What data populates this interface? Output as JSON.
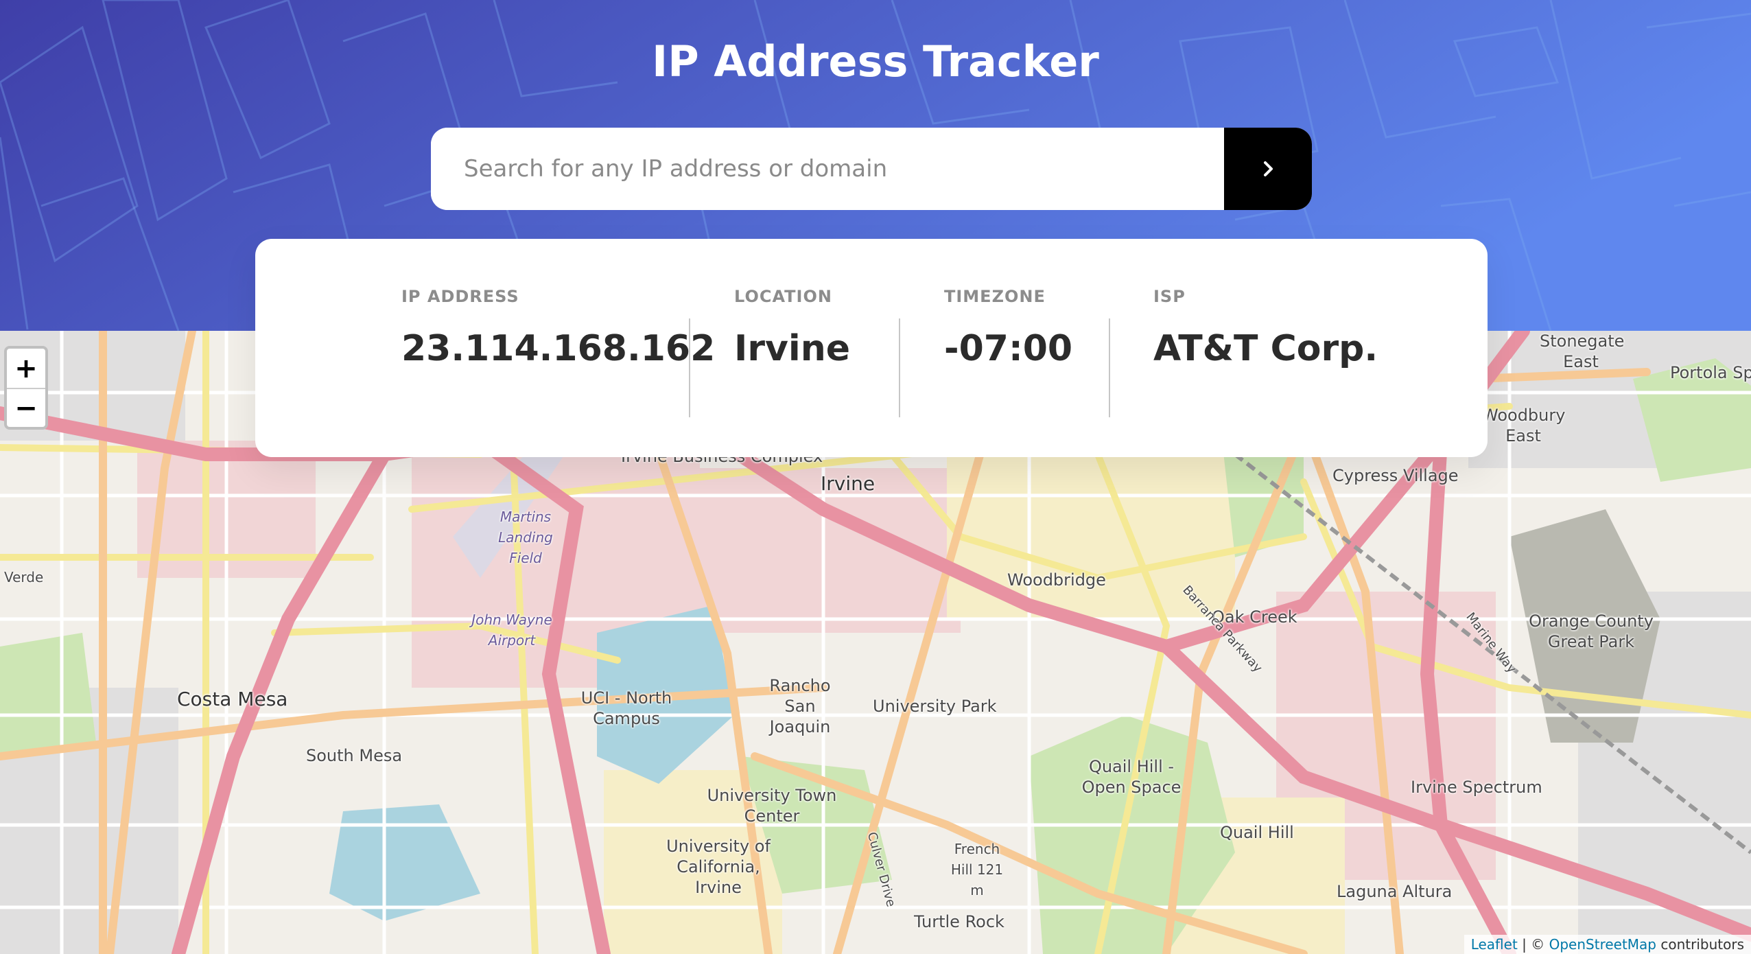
{
  "header": {
    "title": "IP Address Tracker",
    "gradient_start": "#3f3fa8",
    "gradient_end": "#5f87ee"
  },
  "search": {
    "placeholder": "Search for any IP address or domain",
    "value": "",
    "submit_icon": "chevron-right-icon"
  },
  "info": {
    "ip": {
      "label": "IP ADDRESS",
      "value": "23.114.168.162"
    },
    "location": {
      "label": "LOCATION",
      "value": "Irvine"
    },
    "timezone": {
      "label": "TIMEZONE",
      "value": "-07:00"
    },
    "isp": {
      "label": "ISP",
      "value": "AT&T Corp."
    }
  },
  "map": {
    "zoom_in": "+",
    "zoom_out": "−",
    "attribution": {
      "leaflet": "Leaflet",
      "separator": " | © ",
      "osm": "OpenStreetMap",
      "suffix": " contributors"
    },
    "labels": {
      "irvine": "Irvine",
      "business_complex": "Irvine Business Complex",
      "cypress_village": "Cypress Village",
      "stonegate_east": "Stonegate East",
      "portola": "Portola Sp",
      "woodbury_east": "Woodbury East",
      "woodbridge": "Woodbridge",
      "oak_creek": "Oak Creek",
      "orange_county_great_park": "Orange County Great Park",
      "costa_mesa": "Costa Mesa",
      "south_mesa": "South Mesa",
      "uci_north_campus": "UCI - North Campus",
      "rancho_san_joaquin": "Rancho San Joaquin",
      "university_park": "University Park",
      "quail_hill_open_space": "Quail Hill - Open Space",
      "irvine_spectrum": "Irvine Spectrum",
      "quail_hill": "Quail Hill",
      "university_town_center": "University Town Center",
      "uc_irvine": "University of California, Irvine",
      "french_hill": "French Hill 121 m",
      "turtle_rock": "Turtle Rock",
      "laguna_altura": "Laguna Altura",
      "martins_landing_field": "Martins Landing Field",
      "john_wayne_airport": "John Wayne Airport",
      "verde": "Verde",
      "barranca_parkway": "Barranca Parkway",
      "culver_drive": "Culver Drive",
      "marine_way": "Marine Way"
    }
  }
}
